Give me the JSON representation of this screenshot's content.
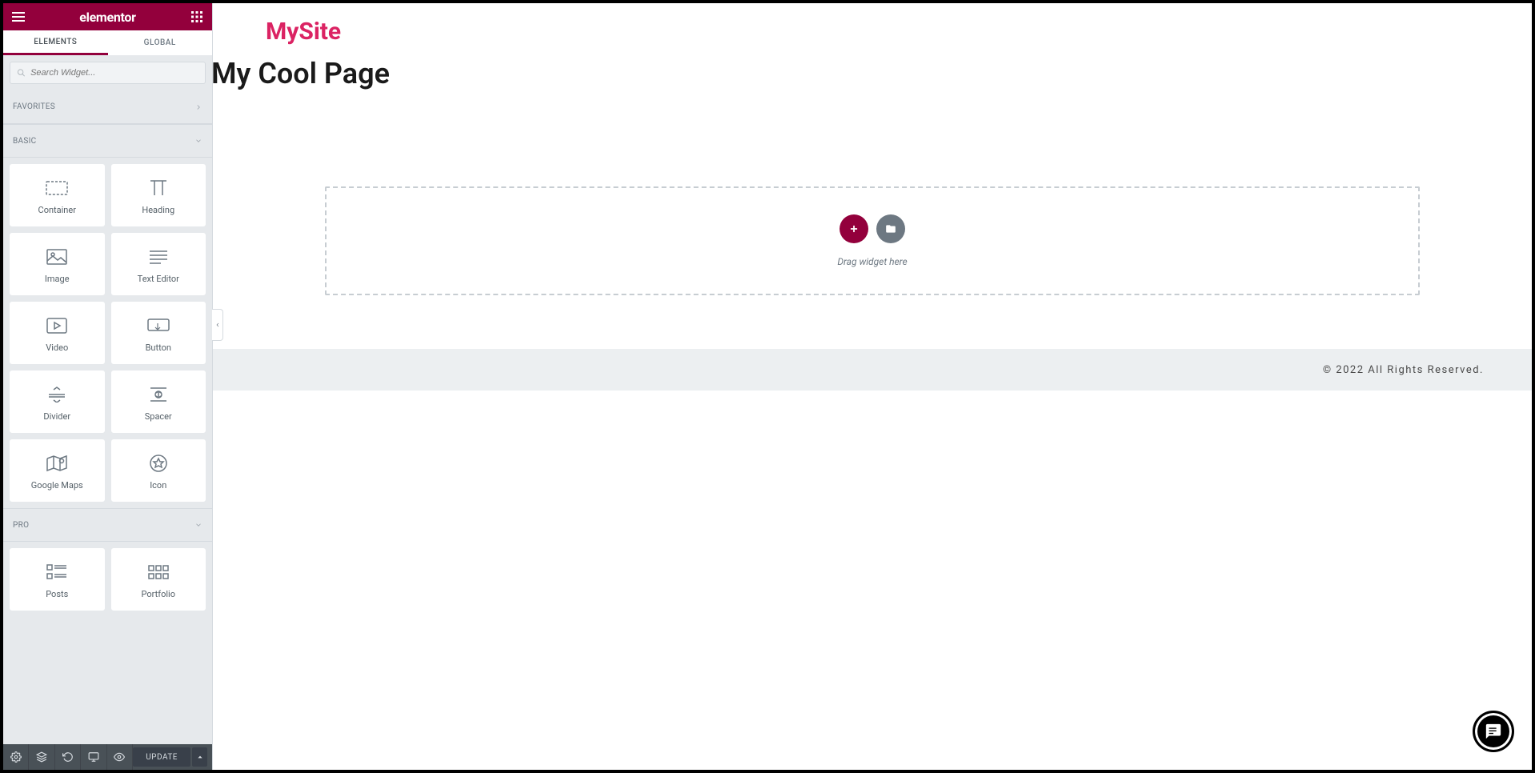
{
  "header": {
    "logo": "elementor"
  },
  "tabs": {
    "elements": "ELEMENTS",
    "global": "GLOBAL"
  },
  "search": {
    "placeholder": "Search Widget..."
  },
  "categories": {
    "favorites": "FAVORITES",
    "basic": "BASIC",
    "pro": "PRO"
  },
  "widgets": {
    "basic": [
      {
        "label": "Container",
        "icon": "container"
      },
      {
        "label": "Heading",
        "icon": "heading"
      },
      {
        "label": "Image",
        "icon": "image"
      },
      {
        "label": "Text Editor",
        "icon": "texteditor"
      },
      {
        "label": "Video",
        "icon": "video"
      },
      {
        "label": "Button",
        "icon": "button"
      },
      {
        "label": "Divider",
        "icon": "divider"
      },
      {
        "label": "Spacer",
        "icon": "spacer"
      },
      {
        "label": "Google Maps",
        "icon": "maps"
      },
      {
        "label": "Icon",
        "icon": "icon"
      }
    ],
    "pro": [
      {
        "label": "Posts",
        "icon": "posts"
      },
      {
        "label": "Portfolio",
        "icon": "portfolio"
      }
    ]
  },
  "bottomBar": {
    "update": "UPDATE"
  },
  "page": {
    "siteTitle": "MySite",
    "pageTitle": "My Cool Page",
    "dropText": "Drag widget here",
    "footer": "© 2022 All Rights Reserved."
  },
  "colors": {
    "brand": "#93003c",
    "accent": "#db2363"
  }
}
